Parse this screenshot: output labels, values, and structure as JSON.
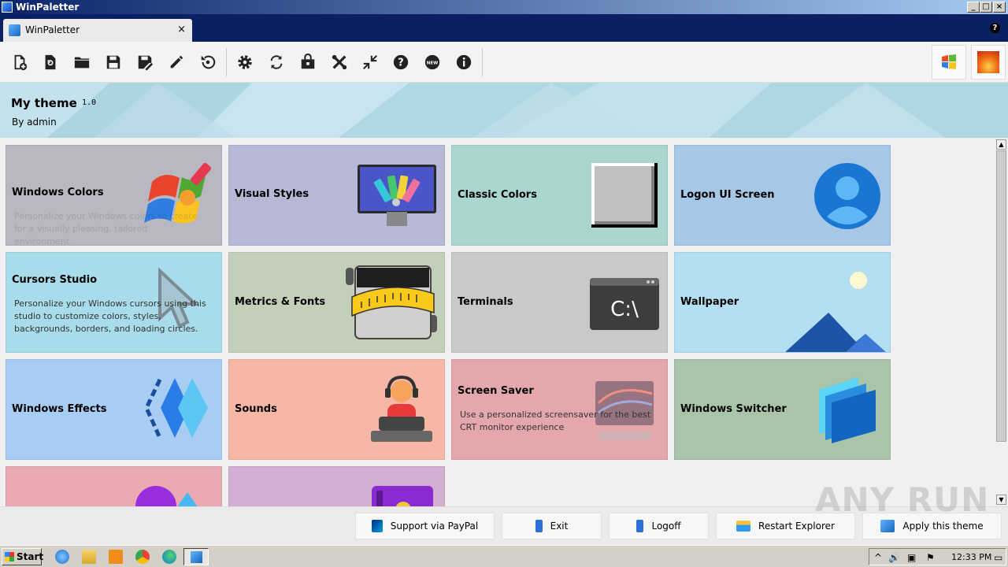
{
  "window": {
    "title": "WinPaletter"
  },
  "tab": {
    "label": "WinPaletter",
    "close": "×"
  },
  "toolbar": {
    "buttons": [
      "new-file-icon",
      "open-recent-icon",
      "folder-icon",
      "save-icon",
      "save-as-icon",
      "edit-icon",
      "restore-icon",
      "settings-icon",
      "sync-icon",
      "store-icon",
      "tools-icon",
      "collapse-icon",
      "help-icon",
      "new-badge-icon",
      "info-icon"
    ]
  },
  "theme": {
    "name": "My theme",
    "version": "1.0",
    "author": "By admin"
  },
  "cards": [
    {
      "title": "Windows Colors",
      "desc": "Personalize your Windows colors to create for a visually pleasing, tailored environment.",
      "color": "#b8b8c2"
    },
    {
      "title": "Visual Styles",
      "desc": "",
      "color": "#b7b7d6"
    },
    {
      "title": "Classic Colors",
      "desc": "",
      "color": "#a9d6d1"
    },
    {
      "title": "Logon UI Screen",
      "desc": "",
      "color": "#a6c8e6"
    },
    {
      "title": "Cursors Studio",
      "desc": "Personalize your Windows cursors using this studio to customize colors, styles, backgrounds, borders, and loading circles.",
      "color": "#a8dcea"
    },
    {
      "title": "Metrics & Fonts",
      "desc": "",
      "color": "#c4cfb9"
    },
    {
      "title": "Terminals",
      "desc": "",
      "color": "#c9c9c9"
    },
    {
      "title": "Wallpaper",
      "desc": "",
      "color": "#b4dff2"
    },
    {
      "title": "Windows Effects",
      "desc": "",
      "color": "#a7cdf2"
    },
    {
      "title": "Sounds",
      "desc": "",
      "color": "#f6b7a6"
    },
    {
      "title": "Screen Saver",
      "desc": "Use a personalized screensaver for the best CRT monitor experience",
      "color": "#e4a7ab"
    },
    {
      "title": "Windows Switcher",
      "desc": "",
      "color": "#a9c4a8"
    },
    {
      "title": "",
      "desc": "",
      "color": "#e9aab4"
    },
    {
      "title": "",
      "desc": "",
      "color": "#d4afd4"
    }
  ],
  "bottom": {
    "paypal": "Support via PayPal",
    "exit": "Exit",
    "logoff": "Logoff",
    "restart": "Restart Explorer",
    "apply": "Apply this theme"
  },
  "watermark": "ANY RUN",
  "taskbar": {
    "start": "Start",
    "clock": "12:33 PM"
  }
}
